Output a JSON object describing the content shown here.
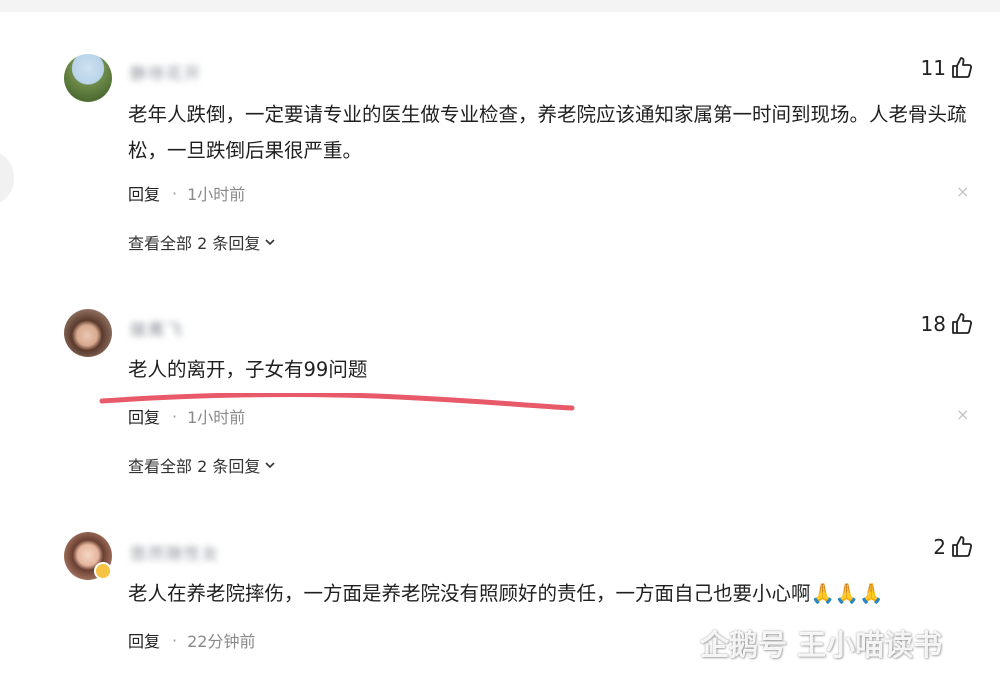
{
  "comments": [
    {
      "username": "静待花开",
      "likes": "11",
      "text": "老年人跌倒，一定要请专业的医生做专业检查，养老院应该通知家属第一时间到现场。人老骨头疏松，一旦跌倒后果很严重。",
      "reply_label": "回复",
      "time": "1小时前",
      "view_all": "查看全部 2 条回复"
    },
    {
      "username": "雄鹰飞",
      "likes": "18",
      "text": "老人的离开，子女有99问题",
      "reply_label": "回复",
      "time": "1小时前",
      "view_all": "查看全部 2 条回复"
    },
    {
      "username": "悠然随性女",
      "likes": "2",
      "text": "老人在养老院摔伤，一方面是养老院没有照顾好的责任，一方面自己也要小心啊🙏🙏🙏",
      "reply_label": "回复",
      "time": "22分钟前"
    }
  ],
  "close_glyph": "×",
  "underline_color": "#e85a6a",
  "watermark": {
    "text": "企鹅号 王小喵读书"
  }
}
